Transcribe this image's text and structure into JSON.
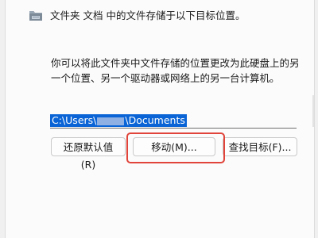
{
  "header": {
    "icon": "folder-icon",
    "text": "文件夹 文档 中的文件存储于以下目标位置。"
  },
  "description": "你可以将此文件夹中文件存储的位置更改为此硬盘上的另一个位置、另一个驱动器或网络上的另一台计算机。",
  "path_field": {
    "value": "C:\\Users\\",
    "redacted_suffix": "\\Documents"
  },
  "buttons": {
    "restore_label": "还原默认值(R)",
    "move_label": "移动(M)...",
    "find_label": "查找目标(F)..."
  },
  "colors": {
    "selection": "#0a64d6",
    "highlight": "#e0443a"
  }
}
